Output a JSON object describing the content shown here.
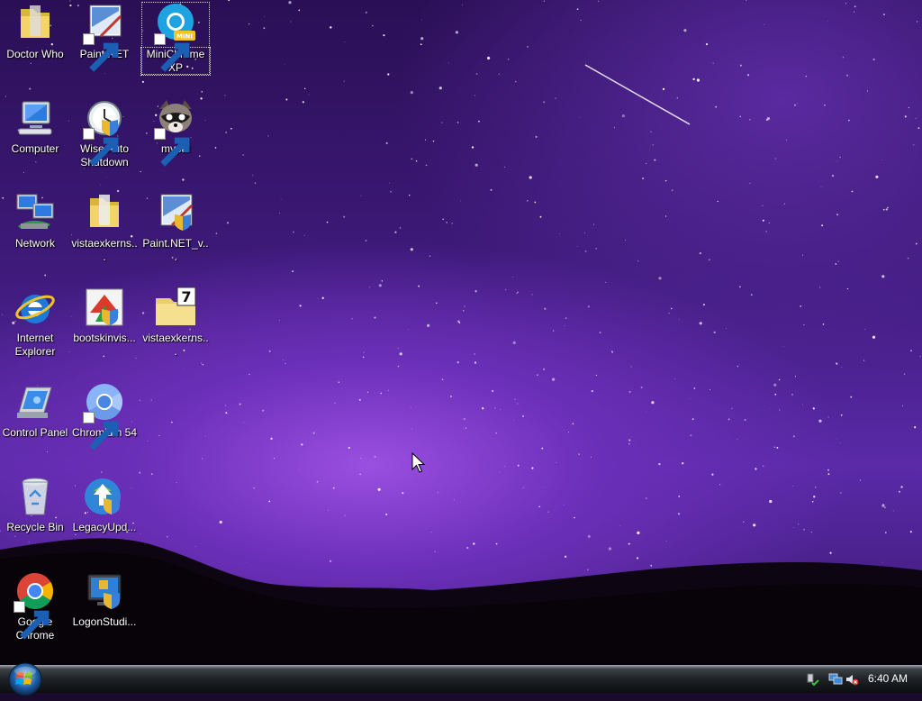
{
  "desktop": {
    "icons": [
      {
        "label": "Doctor Who",
        "icon": "folder-icon"
      },
      {
        "label": "Paint.NET",
        "icon": "paint-net-icon"
      },
      {
        "label": "MiniChrome XP",
        "icon": "minichrome-icon",
        "badge": "MINI"
      },
      {
        "label": "Computer",
        "icon": "computer-icon"
      },
      {
        "label": "Wise Auto Shutdown",
        "icon": "clock-shield-icon"
      },
      {
        "label": "mypal",
        "icon": "raccoon-icon"
      },
      {
        "label": "Network",
        "icon": "network-icon"
      },
      {
        "label": "vistaexkerns...",
        "icon": "folder-icon"
      },
      {
        "label": "Paint.NET_v...",
        "icon": "paint-net-installer-icon"
      },
      {
        "label": "Internet Explorer",
        "icon": "internet-explorer-icon"
      },
      {
        "label": "bootskinvis...",
        "icon": "bootskin-icon"
      },
      {
        "label": "vistaexkerns...",
        "icon": "zip-folder-icon",
        "badge": "7"
      },
      {
        "label": "Control Panel",
        "icon": "control-panel-icon"
      },
      {
        "label": "Chromium 54",
        "icon": "chromium-icon"
      },
      {
        "label": "Recycle Bin",
        "icon": "recycle-bin-icon"
      },
      {
        "label": "LegacyUpd...",
        "icon": "legacy-update-icon"
      },
      {
        "label": "Google Chrome",
        "icon": "chrome-icon"
      },
      {
        "label": "LogonStudi...",
        "icon": "logon-studio-icon"
      }
    ]
  },
  "taskbar": {
    "start_button": "windows-orb-icon",
    "tray_icons": [
      "safely-remove-icon",
      "network-status-icon",
      "volume-muted-icon"
    ],
    "clock": "6:40 AM"
  },
  "colors": {
    "sky_top": "#2a0f55",
    "sky_glow": "#9a4fe0",
    "taskbar": "#1e2226"
  }
}
